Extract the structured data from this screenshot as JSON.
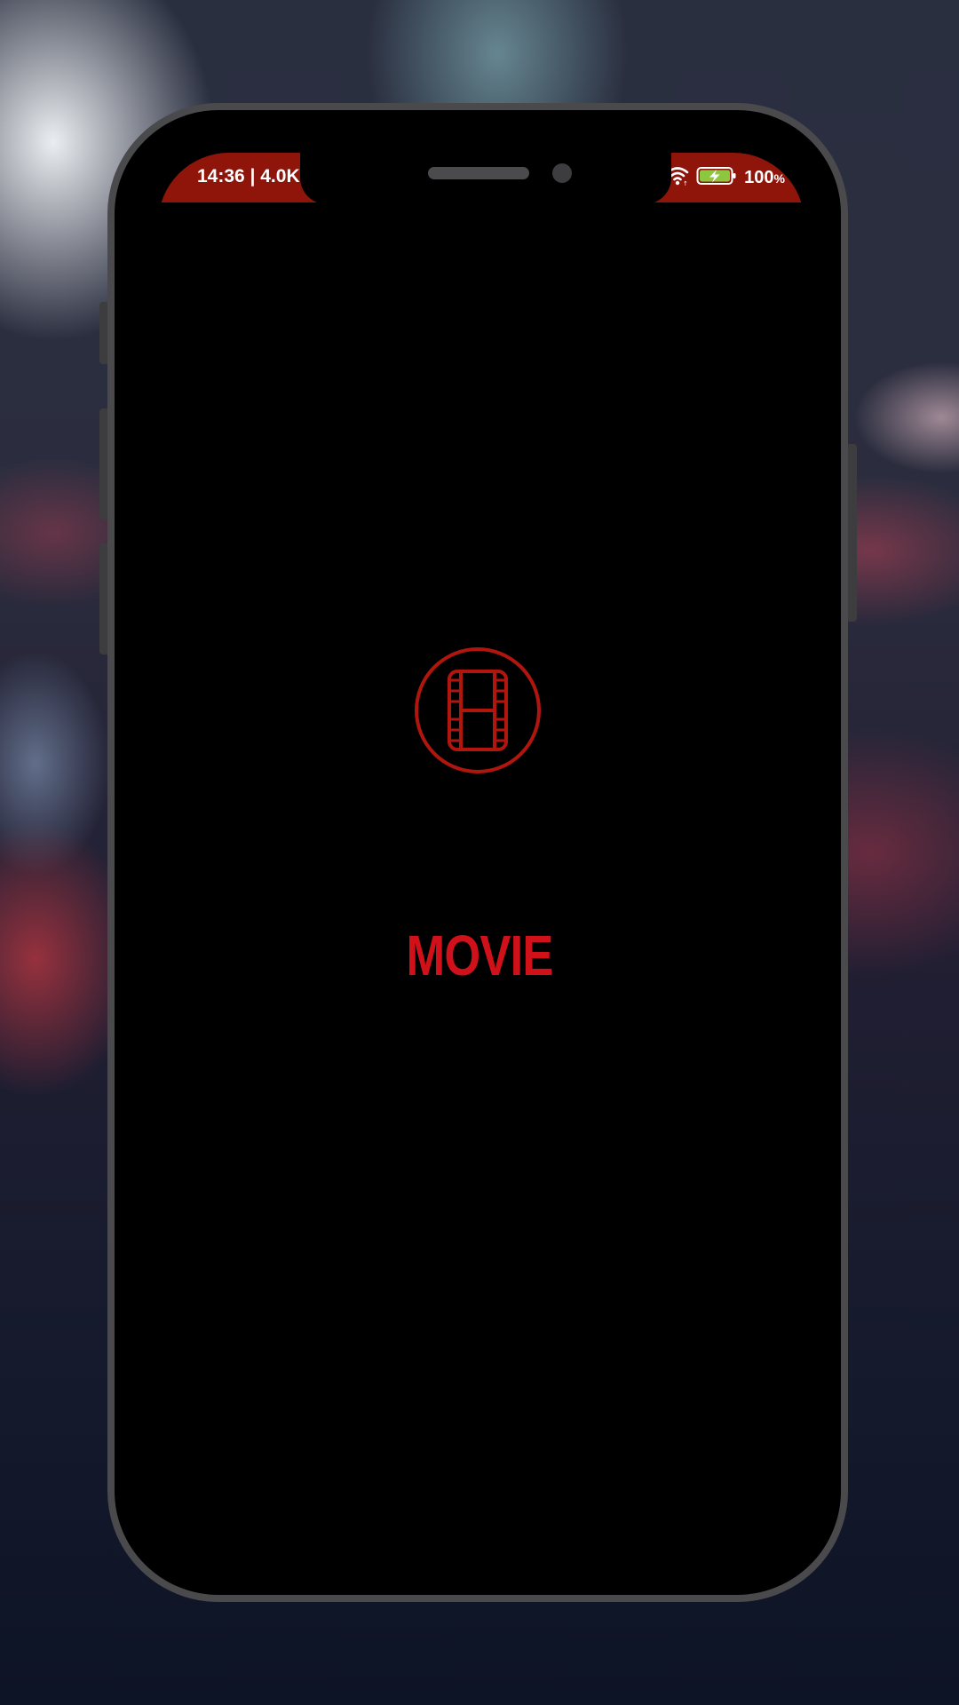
{
  "status_bar": {
    "left_text": "14:36 | 4.0K",
    "battery_percent": "100",
    "battery_unit": "%",
    "icons": [
      "wifi-icon",
      "battery-charging-icon"
    ],
    "background_color": "#8f1409"
  },
  "splash": {
    "logo_icon": "film-reel-icon",
    "title": "MOVIE",
    "accent_color": "#d0111a"
  }
}
